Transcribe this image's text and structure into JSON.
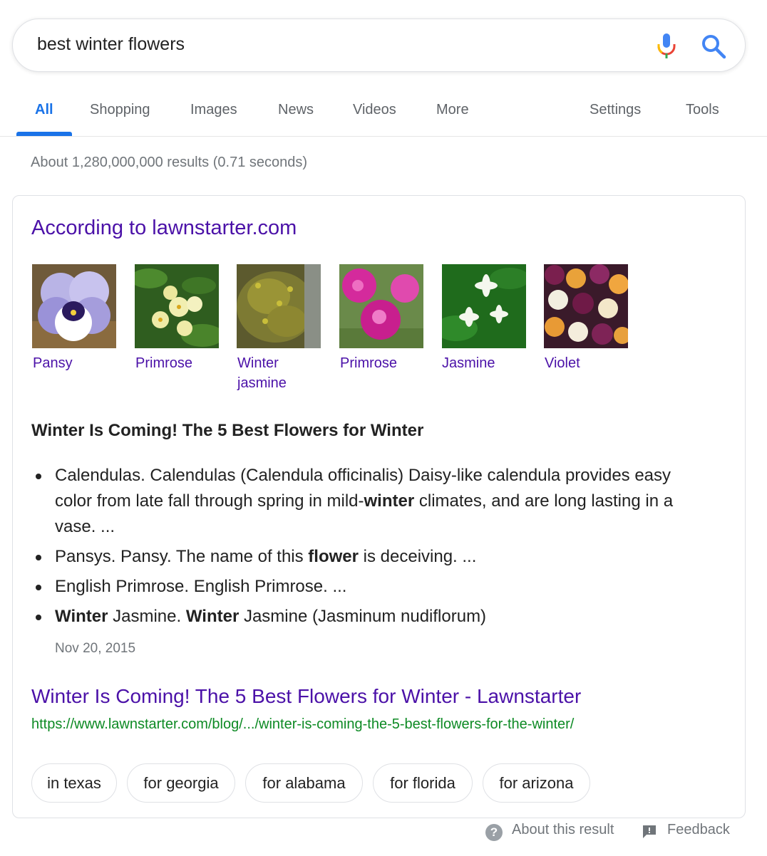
{
  "search": {
    "query": "best winter flowers"
  },
  "tabs": [
    {
      "label": "All",
      "active": true
    },
    {
      "label": "Shopping"
    },
    {
      "label": "Images"
    },
    {
      "label": "News"
    },
    {
      "label": "Videos"
    },
    {
      "label": "More"
    },
    {
      "label": "Settings"
    },
    {
      "label": "Tools"
    }
  ],
  "result_stats": "About 1,280,000,000 results (0.71 seconds)",
  "featured": {
    "source": "According to lawnstarter.com",
    "images": [
      {
        "label_line1": "Pansy",
        "label_line2": ""
      },
      {
        "label_line1": "Primrose",
        "label_line2": ""
      },
      {
        "label_line1": "Winter",
        "label_line2": "jasmine"
      },
      {
        "label_line1": "Primrose",
        "label_line2": ""
      },
      {
        "label_line1": "Jasmine",
        "label_line2": ""
      },
      {
        "label_line1": "Violet",
        "label_line2": ""
      }
    ],
    "title": "Winter Is Coming! The 5 Best Flowers for Winter",
    "bullets": [
      {
        "a": "Calendulas. Calendulas (Calendula officinalis) Daisy-like calendula provides easy color from late fall through spring in mild-",
        "b": "winter",
        "c": " climates, and are long lasting in a vase. ..."
      },
      {
        "a": "Pansys. Pansy. The name of this ",
        "b": "flower",
        "c": " is deceiving. ..."
      },
      {
        "a": "English Primrose. English Primrose. ...",
        "b": "",
        "c": ""
      },
      {
        "a": "",
        "b": "Winter",
        "c": " Jasmine. ",
        "d": "Winter",
        "e": " Jasmine (Jasminum nudiflorum)"
      }
    ],
    "date": "Nov 20, 2015",
    "link_title": "Winter Is Coming! The 5 Best Flowers for Winter - Lawnstarter",
    "link_url": "https://www.lawnstarter.com/blog/.../winter-is-coming-the-5-best-flowers-for-the-winter/",
    "chips": [
      "in texas",
      "for georgia",
      "for alabama",
      "for florida",
      "for arizona"
    ]
  },
  "footer": {
    "about": "About this result",
    "feedback": "Feedback"
  },
  "colors": {
    "accent": "#1a73e8",
    "link_visited": "#4b11a8",
    "url_green": "#0d8a24",
    "muted": "#70757a"
  }
}
